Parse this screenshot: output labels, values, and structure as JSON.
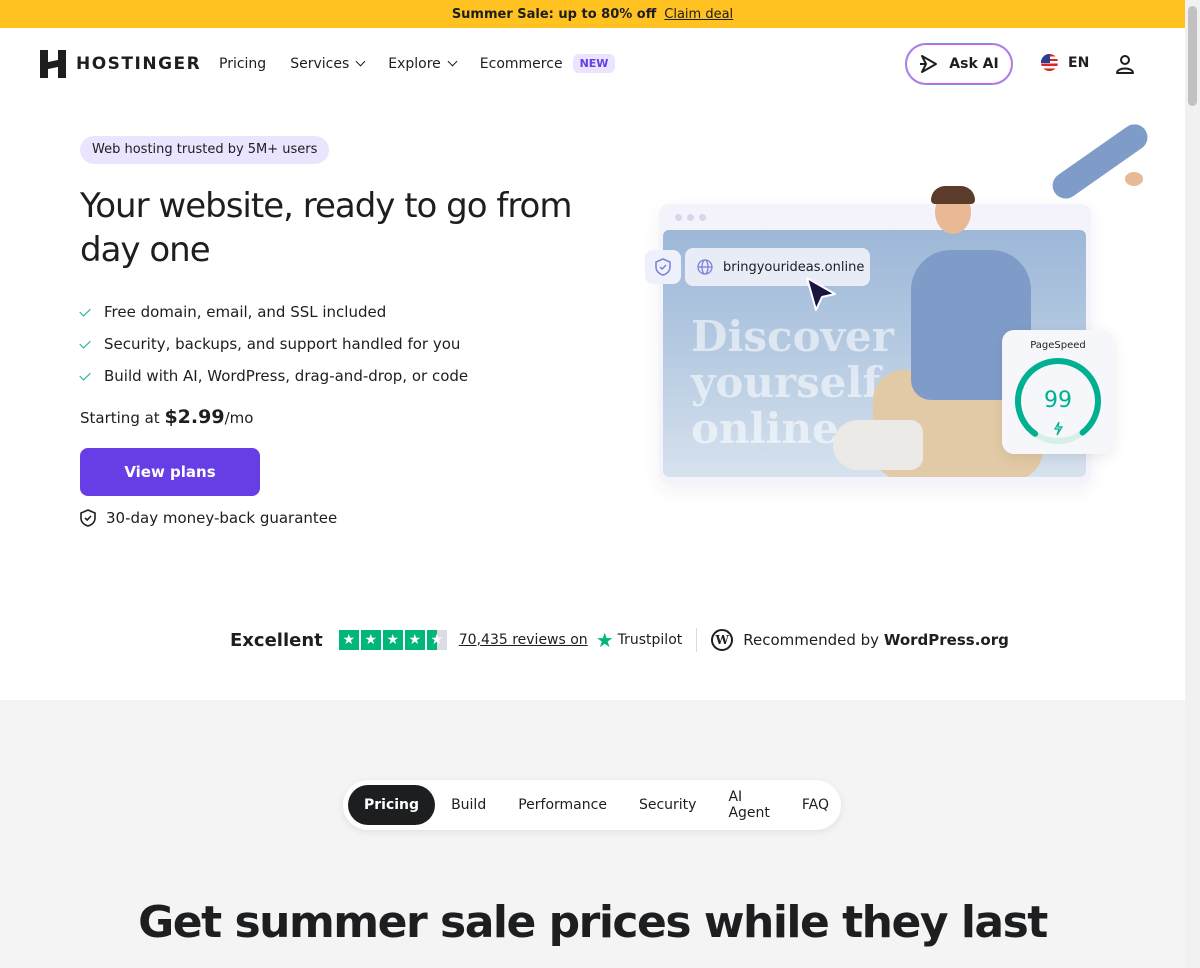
{
  "promo": {
    "text": "Summer Sale: up to 80% off",
    "link": "Claim deal"
  },
  "nav": {
    "brand": "HOSTINGER",
    "links": [
      "Pricing",
      "Services",
      "Explore",
      "Ecommerce"
    ],
    "new_badge": "NEW",
    "ask_ai": "Ask AI",
    "language": "EN"
  },
  "hero": {
    "pill": "Web hosting trusted by 5M+ users",
    "title": "Your website, ready to go from day one",
    "features": [
      "Free domain, email, and SSL included",
      "Security, backups, and support handled for you",
      "Build with AI, WordPress, drag-and-drop, or code"
    ],
    "price_prefix": "Starting at ",
    "price": "$2.99",
    "price_suffix": "/mo",
    "cta": "View plans",
    "guarantee": "30-day money-back guarantee"
  },
  "art": {
    "url": "bringyourideas.online",
    "overlay_text": "Discover yourself online",
    "pagespeed_label": "PageSpeed",
    "pagespeed_value": "99",
    "pagespeed_score": 0.99
  },
  "trust": {
    "rating_word": "Excellent",
    "stars": 4.5,
    "reviews": "70,435 reviews on",
    "trustpilot": "Trustpilot",
    "wp_prefix": "Recommended by ",
    "wp_name": "WordPress.org"
  },
  "tabs": [
    "Pricing",
    "Build",
    "Performance",
    "Security",
    "AI Agent",
    "FAQ"
  ],
  "section_title": "Get summer sale prices while they last",
  "colors": {
    "accent": "#673de6",
    "promo": "#ffc220",
    "success": "#00b090",
    "trustpilot": "#00b67a"
  }
}
